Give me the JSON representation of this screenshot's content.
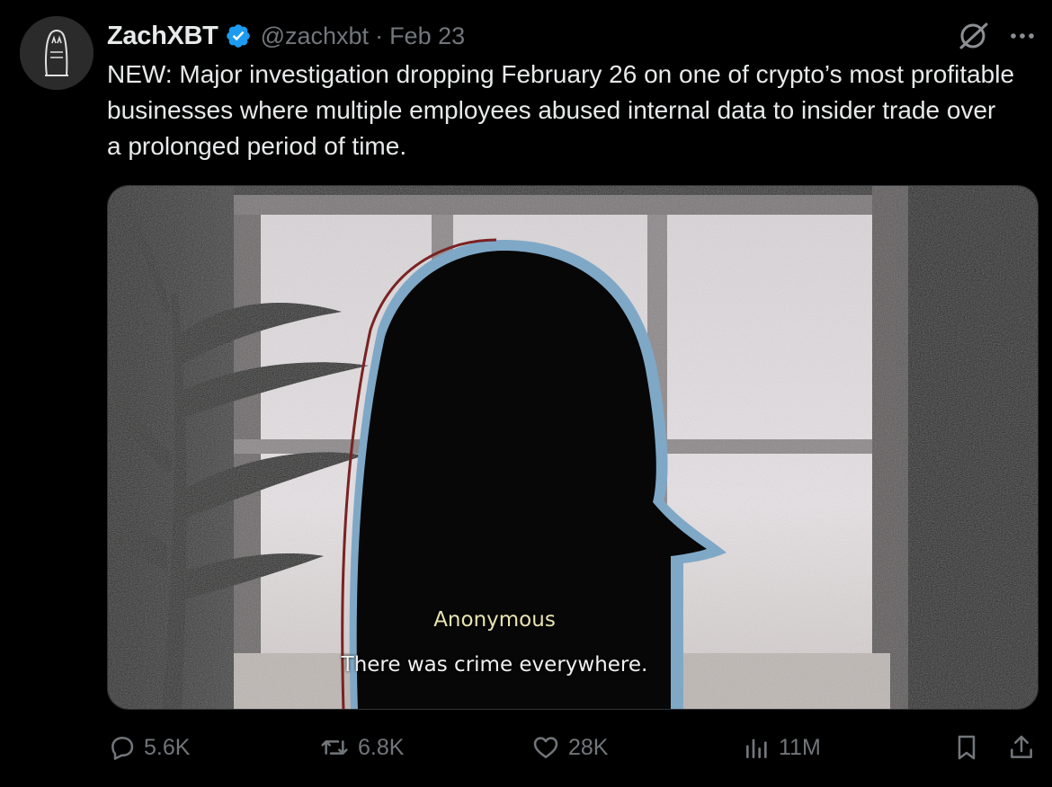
{
  "author": {
    "display_name": "ZachXBT",
    "handle": "@zachxbt",
    "separator": "·",
    "date": "Feb 23",
    "verified": true
  },
  "tweet": {
    "text": "NEW: Major investigation dropping February 26 on one of crypto’s most profitable businesses where multiple employees abused internal data to insider trade over a prolonged period of time."
  },
  "media": {
    "caption_speaker": "Anonymous",
    "caption_line": "There was crime everywhere."
  },
  "actions": {
    "replies": "5.6K",
    "reposts": "6.8K",
    "likes": "28K",
    "views": "11M"
  },
  "icons": {
    "verified": "verified-badge-icon",
    "grok": "grok-icon",
    "more": "more-icon",
    "reply": "reply-icon",
    "repost": "repost-icon",
    "like": "heart-icon",
    "views": "views-chart-icon",
    "bookmark": "bookmark-icon",
    "share": "share-icon"
  },
  "colors": {
    "background": "#000000",
    "primary_text": "#e7e9ea",
    "secondary_text": "#71767b",
    "verified_blue": "#1d9bf0",
    "caption_speaker": "#e8e3b0"
  }
}
